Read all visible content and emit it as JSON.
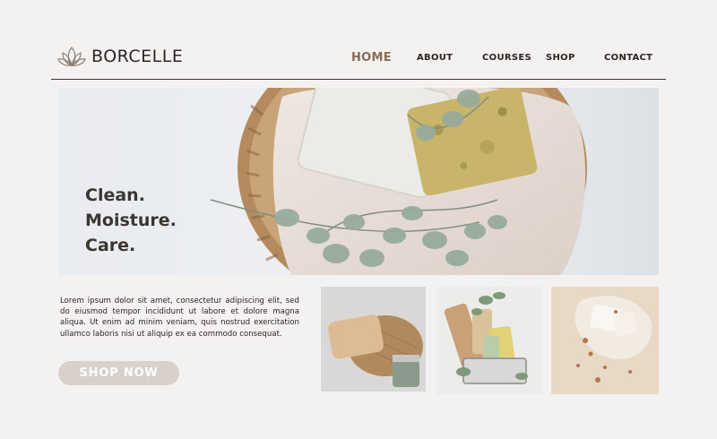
{
  "brand": {
    "name": "BORCELLE",
    "logo_icon": "lotus-icon"
  },
  "nav": [
    {
      "label": "HOME",
      "active": true
    },
    {
      "label": "ABOUT"
    },
    {
      "label": "COURSES"
    },
    {
      "label": "SHOP"
    },
    {
      "label": "CONTACT"
    }
  ],
  "hero": {
    "lines": [
      "Clean.",
      "Moisture.",
      "Care."
    ]
  },
  "intro": {
    "text": "Lorem ipsum dolor sit amet, consectetur adipiscing elit, sed do eiusmod tempor incididunt ut labore et dolore magna aliqua. Ut enim ad minim veniam, quis nostrud exercitation ullamco laboris nisi ut aliquip ex ea commodo consequat."
  },
  "cta": {
    "label": "SHOP NOW"
  },
  "colors": {
    "background": "#f4f2f1",
    "accent": "#8a6a52",
    "button": "#d8d0ca"
  }
}
